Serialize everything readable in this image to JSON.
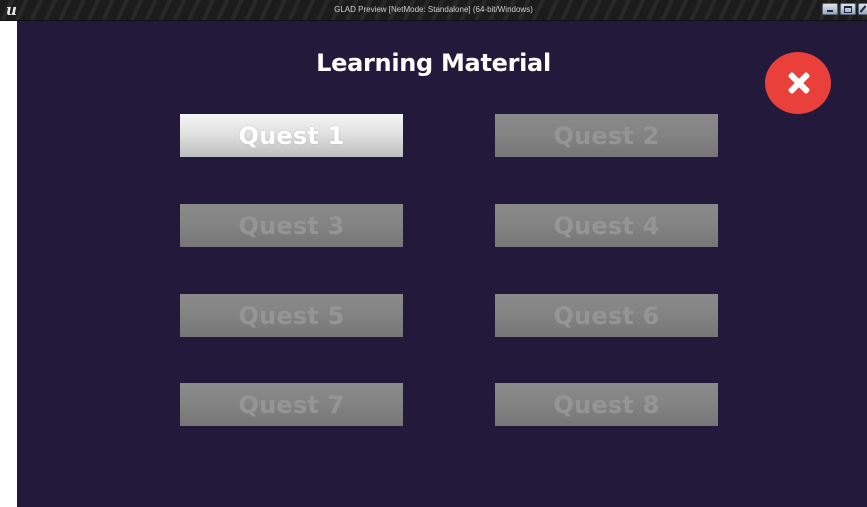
{
  "window": {
    "title": "GLAD Preview [NetMode: Standalone]  (64-bit/Windows)",
    "logo_glyph": "u",
    "controls": [
      {
        "name": "minimize",
        "glyph": "minimize-icon"
      },
      {
        "name": "maximize",
        "glyph": "maximize-icon"
      },
      {
        "name": "close",
        "glyph": "close-icon"
      }
    ]
  },
  "screen": {
    "title": "Learning Material",
    "background_color": "#23193a",
    "close_button": {
      "icon": "close-x-icon",
      "color": "#e9403c"
    }
  },
  "quests": [
    {
      "label": "Quest 1",
      "state": "enabled"
    },
    {
      "label": "Quest 2",
      "state": "disabled"
    },
    {
      "label": "Quest 3",
      "state": "disabled"
    },
    {
      "label": "Quest 4",
      "state": "disabled"
    },
    {
      "label": "Quest 5",
      "state": "disabled"
    },
    {
      "label": "Quest 6",
      "state": "disabled"
    },
    {
      "label": "Quest 7",
      "state": "disabled"
    },
    {
      "label": "Quest 8",
      "state": "disabled"
    }
  ]
}
